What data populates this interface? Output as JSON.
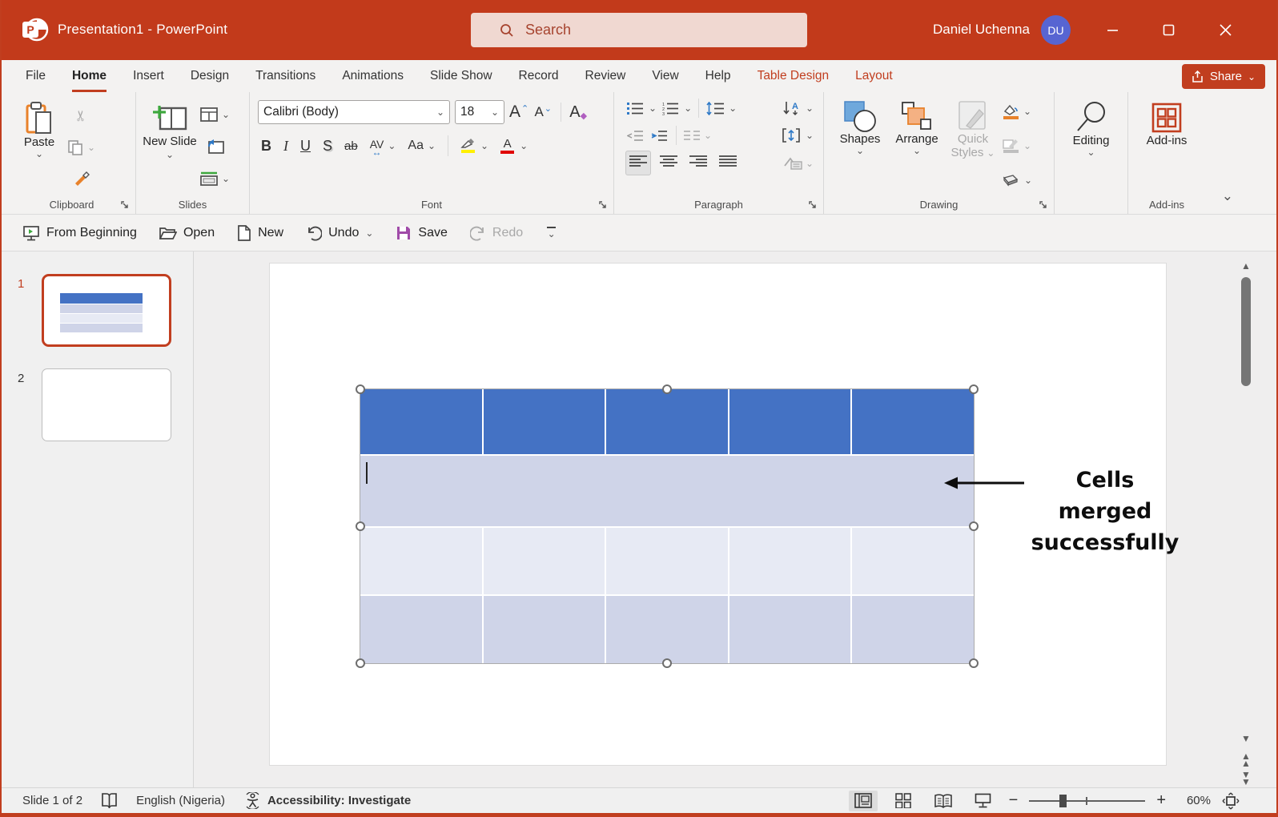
{
  "title_bar": {
    "app_title": "Presentation1  -  PowerPoint",
    "search_placeholder": "Search",
    "user_name": "Daniel Uchenna",
    "user_initials": "DU"
  },
  "tabs": {
    "items": [
      {
        "label": "File"
      },
      {
        "label": "Home",
        "active": true
      },
      {
        "label": "Insert"
      },
      {
        "label": "Design"
      },
      {
        "label": "Transitions"
      },
      {
        "label": "Animations"
      },
      {
        "label": "Slide Show"
      },
      {
        "label": "Record"
      },
      {
        "label": "Review"
      },
      {
        "label": "View"
      },
      {
        "label": "Help"
      },
      {
        "label": "Table Design",
        "contextual": true
      },
      {
        "label": "Layout",
        "contextual": true
      }
    ],
    "share_label": "Share"
  },
  "ribbon": {
    "clipboard": {
      "paste_label": "Paste",
      "group_label": "Clipboard"
    },
    "slides": {
      "new_slide_label": "New Slide",
      "group_label": "Slides"
    },
    "font": {
      "font_name": "Calibri (Body)",
      "font_size": "18",
      "bold": "B",
      "italic": "I",
      "underline": "U",
      "shadow": "S",
      "strikethrough": "ab",
      "char_spacing": "AV",
      "change_case": "Aa",
      "grow_letter": "A",
      "shrink_letter": "A",
      "clear_letter": "A",
      "font_color_letter": "A",
      "group_label": "Font"
    },
    "paragraph": {
      "group_label": "Paragraph"
    },
    "drawing": {
      "shapes_label": "Shapes",
      "arrange_label": "Arrange",
      "quick_styles_line1": "Quick",
      "quick_styles_line2": "Styles",
      "group_label": "Drawing"
    },
    "editing": {
      "label": "Editing"
    },
    "addins": {
      "button_label": "Add-ins",
      "group_label": "Add-ins"
    }
  },
  "quick_toolbar": {
    "from_beginning": "From Beginning",
    "open": "Open",
    "new": "New",
    "undo": "Undo",
    "save": "Save",
    "redo": "Redo"
  },
  "slide_panel": {
    "slides": [
      {
        "number": "1"
      },
      {
        "number": "2"
      }
    ]
  },
  "canvas": {
    "annotation_line1": "Cells merged",
    "annotation_line2": "successfully",
    "table": {
      "rows": 4,
      "columns": 5,
      "merged_row_index": 2
    }
  },
  "status_bar": {
    "slide_indicator": "Slide 1 of 2",
    "language": "English (Nigeria)",
    "accessibility": "Accessibility: Investigate",
    "zoom_out": "−",
    "zoom_in": "+",
    "zoom_level": "60%"
  },
  "colors": {
    "titlebar": "#C23A1B",
    "accent": "#C13E1F",
    "search_box_bg": "#F0D8D1",
    "search_text": "#A6432E",
    "avatar_bg": "#5765D2",
    "ribbon_bg": "#F3F2F1",
    "canvas_bg": "#EFEEEE",
    "table_header": "#4472C4",
    "band_dark": "#CFD4E8",
    "band_light": "#E7EAF4",
    "icon_blue": "#2E79C7",
    "icon_orange": "#E8822B",
    "icon_green": "#3DA83D",
    "disabled": "#A8A8A8",
    "highlight_yellow": "#FFF000",
    "font_color_red": "#E00000",
    "save_purple": "#A04BA8"
  }
}
